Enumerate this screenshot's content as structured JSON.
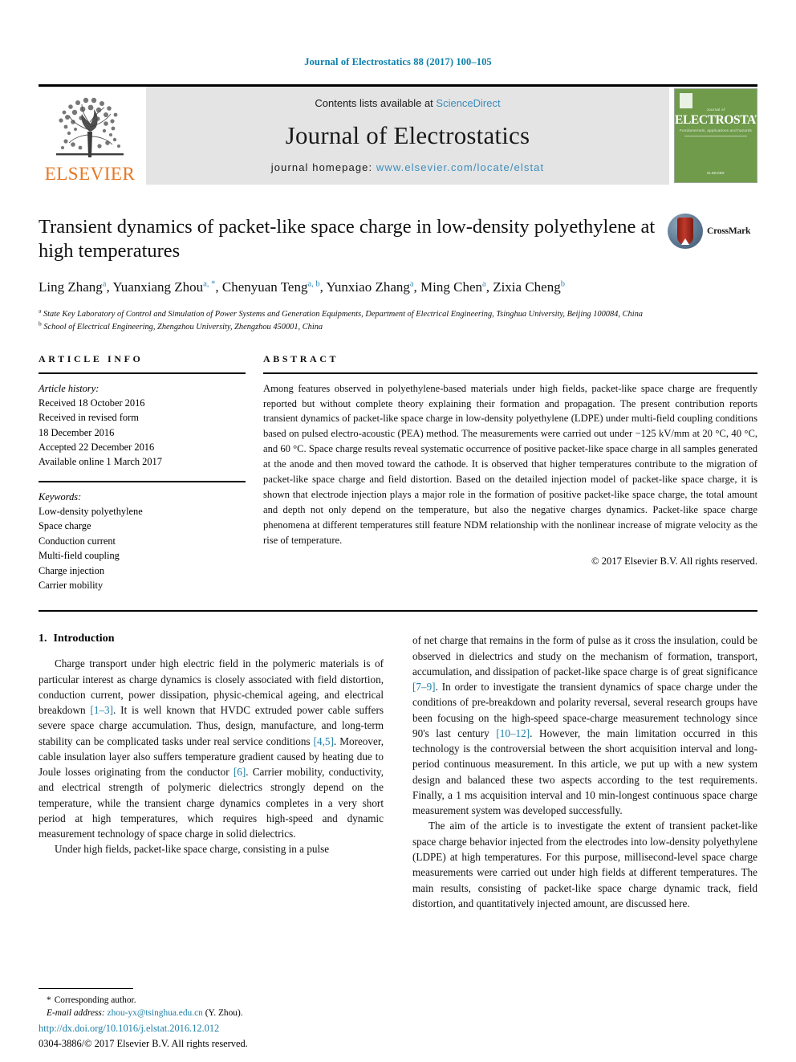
{
  "running_head": "Journal of Electrostatics 88 (2017) 100–105",
  "masthead": {
    "publisher_wordmark": "ELSEVIER",
    "contents_prefix": "Contents lists available at ",
    "contents_link": "ScienceDirect",
    "journal_name": "Journal of Electrostatics",
    "homepage_prefix": "journal homepage: ",
    "homepage_url": "www.elsevier.com/locate/elstat",
    "cover": {
      "eyebrow": "Journal of",
      "title": "ELECTROSTATICS",
      "subtitle": "Fundamentals, applications and hazards",
      "footer": "ELSEVIER"
    },
    "accent_link_color": "#3c8dbc",
    "band_color": "#e4e4e4",
    "elsevier_orange": "#e87722",
    "cover_green": "#6f9b4b"
  },
  "article": {
    "title": "Transient dynamics of packet-like space charge in low-density polyethylene at high temperatures",
    "authors": [
      {
        "name": "Ling Zhang",
        "marks": "a"
      },
      {
        "name": "Yuanxiang Zhou",
        "marks": "a, *"
      },
      {
        "name": "Chenyuan Teng",
        "marks": "a, b"
      },
      {
        "name": "Yunxiao Zhang",
        "marks": "a"
      },
      {
        "name": "Ming Chen",
        "marks": "a"
      },
      {
        "name": "Zixia Cheng",
        "marks": "b"
      }
    ],
    "affiliations": [
      {
        "mark": "a",
        "text": "State Key Laboratory of Control and Simulation of Power Systems and Generation Equipments, Department of Electrical Engineering, Tsinghua University, Beijing 100084, China"
      },
      {
        "mark": "b",
        "text": "School of Electrical Engineering, Zhengzhou University, Zhengzhou 450001, China"
      }
    ],
    "crossmark_label": "CrossMark"
  },
  "article_info": {
    "heading": "ARTICLE INFO",
    "history_label": "Article history:",
    "history": [
      "Received 18 October 2016",
      "Received in revised form",
      "18 December 2016",
      "Accepted 22 December 2016",
      "Available online 1 March 2017"
    ],
    "keywords_label": "Keywords:",
    "keywords": [
      "Low-density polyethylene",
      "Space charge",
      "Conduction current",
      "Multi-field coupling",
      "Charge injection",
      "Carrier mobility"
    ]
  },
  "abstract": {
    "heading": "ABSTRACT",
    "text": "Among features observed in polyethylene-based materials under high fields, packet-like space charge are frequently reported but without complete theory explaining their formation and propagation. The present contribution reports transient dynamics of packet-like space charge in low-density polyethylene (LDPE) under multi-field coupling conditions based on pulsed electro-acoustic (PEA) method. The measurements were carried out under −125 kV/mm at 20 °C, 40 °C, and 60 °C. Space charge results reveal systematic occurrence of positive packet-like space charge in all samples generated at the anode and then moved toward the cathode. It is observed that higher temperatures contribute to the migration of packet-like space charge and field distortion. Based on the detailed injection model of packet-like space charge, it is shown that electrode injection plays a major role in the formation of positive packet-like space charge, the total amount and depth not only depend on the temperature, but also the negative charges dynamics. Packet-like space charge phenomena at different temperatures still feature NDM relationship with the nonlinear increase of migrate velocity as the rise of temperature.",
    "copyright": "© 2017 Elsevier B.V. All rights reserved."
  },
  "body": {
    "section_number": "1.",
    "section_title": "Introduction",
    "left_paragraphs": [
      "Charge transport under high electric field in the polymeric materials is of particular interest as charge dynamics is closely associated with field distortion, conduction current, power dissipation, physic-chemical ageing, and electrical breakdown [1–3]. It is well known that HVDC extruded power cable suffers severe space charge accumulation. Thus, design, manufacture, and long-term stability can be complicated tasks under real service conditions [4,5]. Moreover, cable insulation layer also suffers temperature gradient caused by heating due to Joule losses originating from the conductor [6]. Carrier mobility, conductivity, and electrical strength of polymeric dielectrics strongly depend on the temperature, while the transient charge dynamics completes in a very short period at high temperatures, which requires high-speed and dynamic measurement technology of space charge in solid dielectrics.",
      "Under high fields, packet-like space charge, consisting in a pulse"
    ],
    "right_paragraphs": [
      "of net charge that remains in the form of pulse as it cross the insulation, could be observed in dielectrics and study on the mechanism of formation, transport, accumulation, and dissipation of packet-like space charge is of great significance [7–9]. In order to investigate the transient dynamics of space charge under the conditions of pre-breakdown and polarity reversal, several research groups have been focusing on the high-speed space-charge measurement technology since 90's last century [10–12]. However, the main limitation occurred in this technology is the controversial between the short acquisition interval and long-period continuous measurement. In this article, we put up with a new system design and balanced these two aspects according to the test requirements. Finally, a 1 ms acquisition interval and 10 min-longest continuous space charge measurement system was developed successfully.",
      "The aim of the article is to investigate the extent of transient packet-like space charge behavior injected from the electrodes into low-density polyethylene (LDPE) at high temperatures. For this purpose, millisecond-level space charge measurements were carried out under high fields at different temperatures. The main results, consisting of packet-like space charge dynamic track, field distortion, and quantitatively injected amount, are discussed here."
    ]
  },
  "footer": {
    "corresponding_marker": "*",
    "corresponding_label": "Corresponding author.",
    "email_label": "E-mail address:",
    "email": "zhou-yx@tsinghua.edu.cn",
    "email_suffix": "(Y. Zhou).",
    "doi_url": "http://dx.doi.org/10.1016/j.elstat.2016.12.012",
    "issn_line": "0304-3886/© 2017 Elsevier B.V. All rights reserved.",
    "link_color": "#1d7fa8"
  }
}
